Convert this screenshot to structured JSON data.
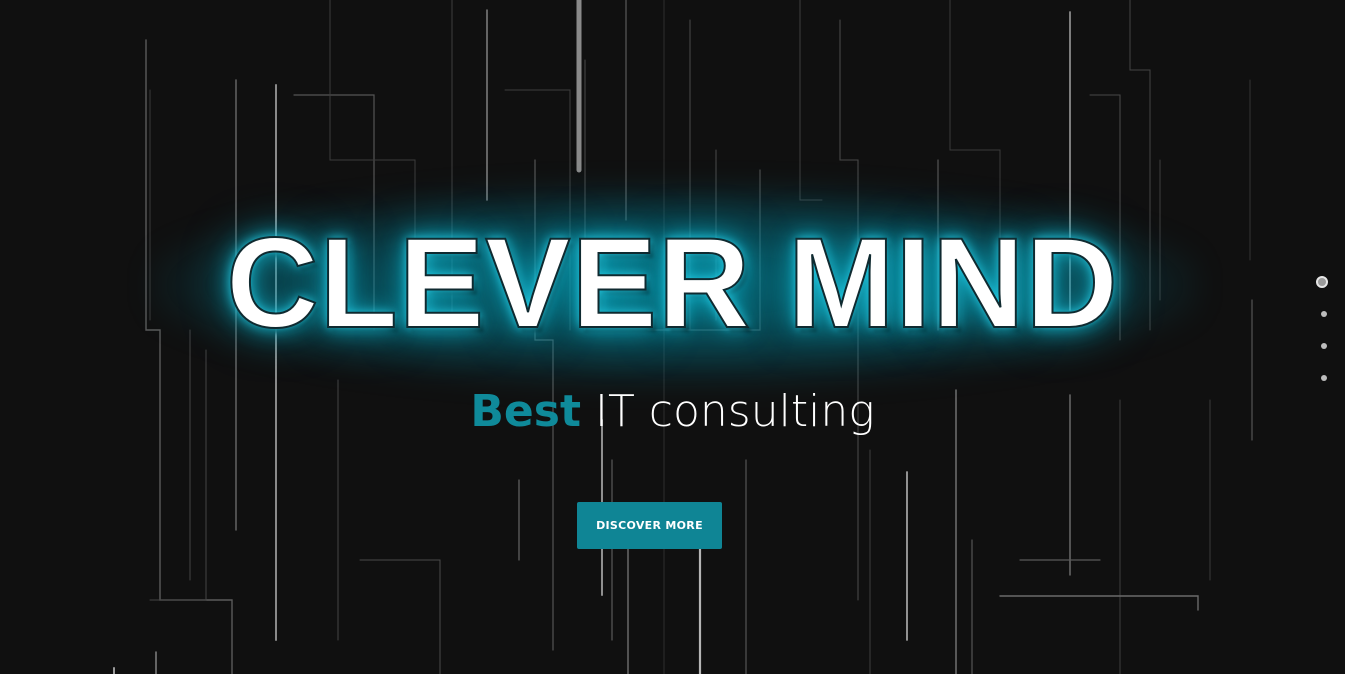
{
  "hero": {
    "title": "CLEVER MIND",
    "subtitle_accent": "Best",
    "subtitle_rest": " IT consulting",
    "cta_label": "DISCOVER MORE"
  },
  "slider": {
    "slide_count": 4,
    "active_index": 0
  },
  "colors": {
    "accent": "#0f8a9a",
    "button": "#0f8595",
    "background": "#101010",
    "glow": "#00a0b9"
  }
}
